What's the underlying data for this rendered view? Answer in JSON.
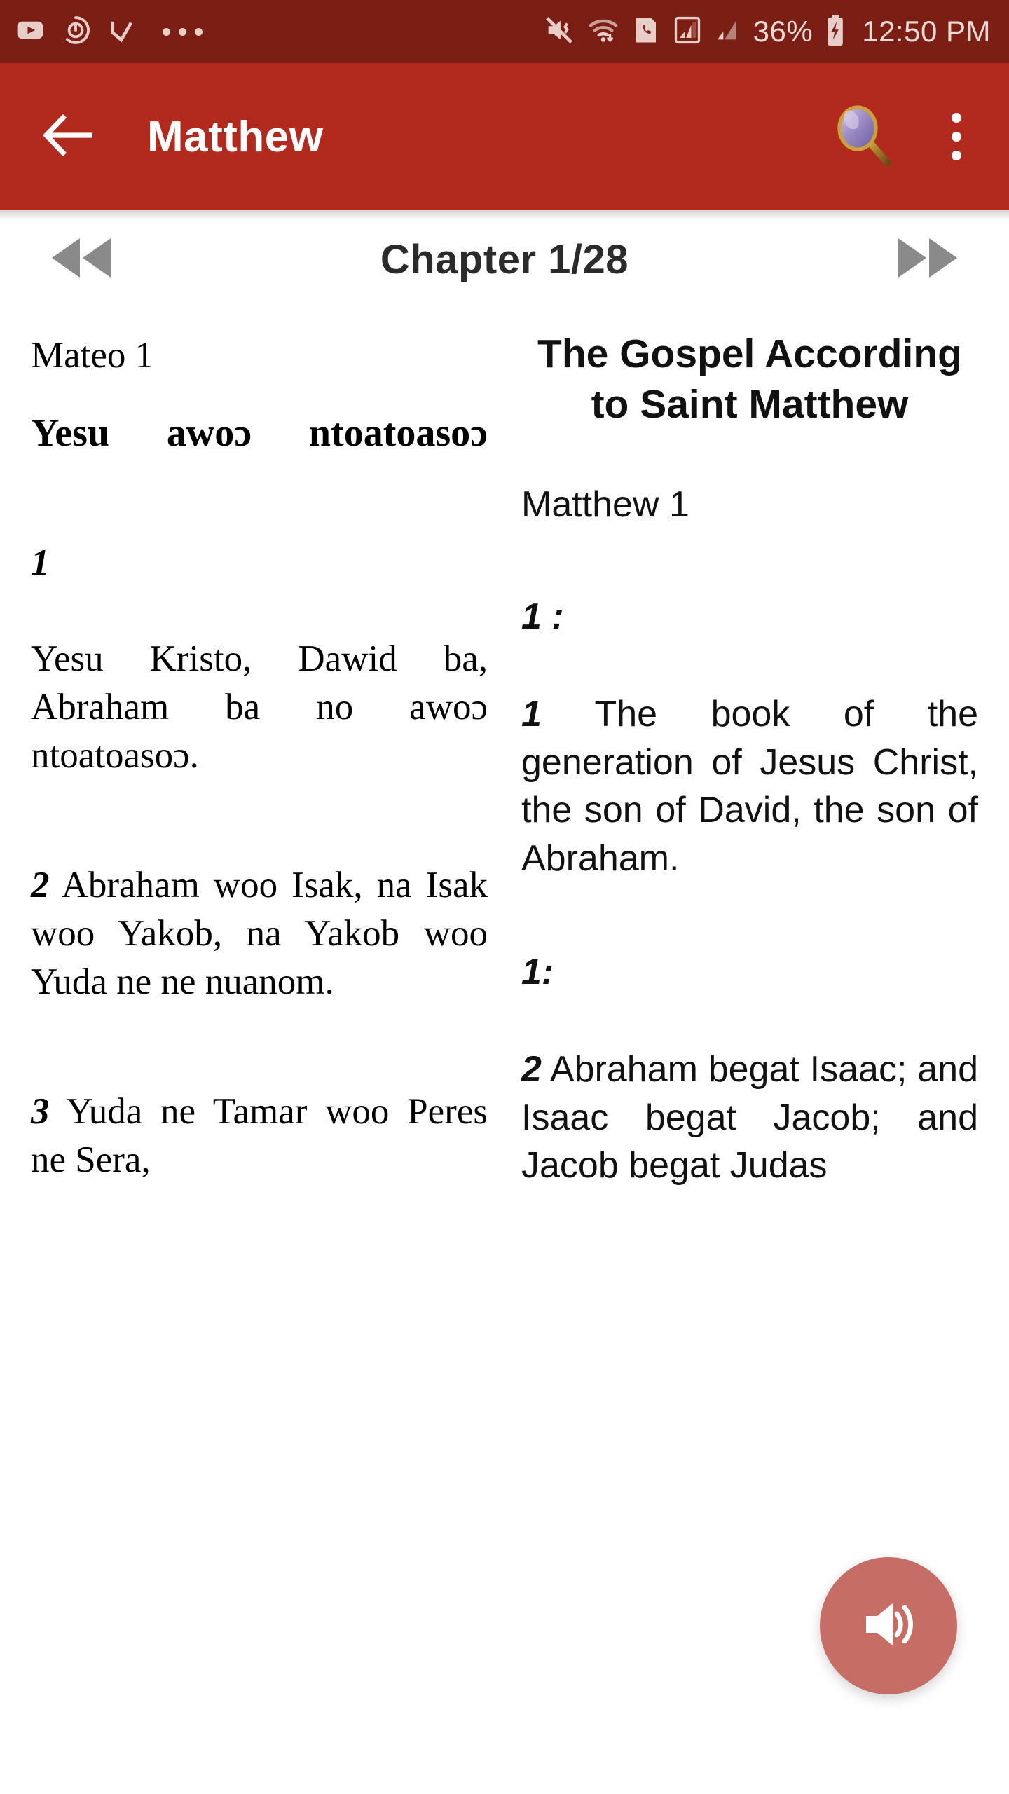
{
  "status_bar": {
    "left_icons": [
      "youtube-icon",
      "power-circle-icon",
      "checkmark-arrow-icon",
      "more-dots-icon"
    ],
    "right_icons": [
      "vibrate-off-icon",
      "wifi-icon",
      "sim-phone-icon",
      "signal-bars-icon",
      "signal-bars-2-icon",
      "battery-charging-icon"
    ],
    "battery": "36%",
    "clock": "12:50 PM",
    "background": "#7B1E14",
    "foreground": "#E8CEC9"
  },
  "app_bar": {
    "back_icon": "back-arrow-icon",
    "title": "Matthew",
    "search_icon": "magnifier-icon",
    "overflow_icon": "overflow-menu-icon",
    "background": "#B22A1E",
    "foreground": "#FFFFFF"
  },
  "chapter_nav": {
    "prev_icon": "rewind-icon",
    "label": "Chapter 1/28",
    "next_icon": "fast-forward-icon"
  },
  "reader": {
    "left_column": {
      "book_ref": "Mateo 1",
      "section_heading": "Yesu awoɔ ntoatoasoɔ",
      "verses": [
        {
          "num": "1",
          "text": "Yesu Kristo, Dawid ba, Abraham ba no awoɔ ntoatoasoɔ."
        },
        {
          "num": "2",
          "text": "Abraham woo Isak, na Isak woo Yakob, na Yakob woo Yuda ne ne nuanom."
        },
        {
          "num": "3",
          "text": "Yuda ne Tamar woo Peres ne Sera,"
        }
      ]
    },
    "right_column": {
      "book_title": "The Gospel According to Saint Matthew",
      "book_ref": "Matthew 1",
      "label_1": "1 :",
      "label_2": "1:",
      "verses": [
        {
          "num": "1",
          "text": "The book of the generation of Jesus Christ, the son of David, the son of Abraham."
        },
        {
          "num": "2",
          "text": "Abraham begat Isaac; and Isaac begat Jacob; and Jacob begat Judas"
        }
      ]
    }
  },
  "fab": {
    "icon": "speaker-volume-icon",
    "color": "#B23A30"
  }
}
